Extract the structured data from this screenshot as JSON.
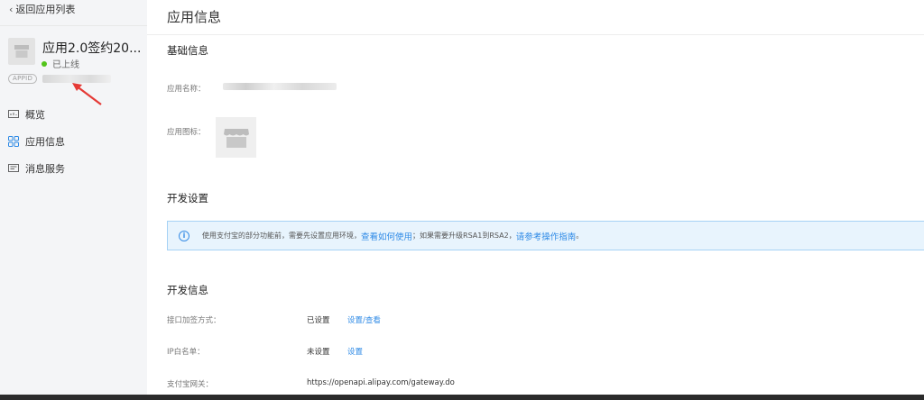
{
  "sidebar": {
    "back_label": "返回应用列表",
    "app": {
      "name": "应用2.0签约20...",
      "status": "已上线",
      "appid_badge": "APPID"
    },
    "nav": [
      {
        "label": "概览",
        "icon": "overview-icon"
      },
      {
        "label": "应用信息",
        "icon": "grid-icon"
      },
      {
        "label": "消息服务",
        "icon": "message-icon"
      }
    ]
  },
  "main": {
    "title": "应用信息",
    "basic": {
      "title": "基础信息",
      "name_label": "应用名称：",
      "icon_label": "应用图标："
    },
    "dev_settings": {
      "title": "开发设置",
      "banner_text_1": "使用支付宝的部分功能前，需要先设置应用环境，",
      "banner_link_1": "查看如何使用",
      "banner_text_2": "；如果需要升级RSA1到RSA2，",
      "banner_link_2": "请参考操作指南",
      "banner_end": "。"
    },
    "dev_info": {
      "title": "开发信息",
      "rows": [
        {
          "label": "接口加签方式：",
          "value": "已设置",
          "link": "设置/查看"
        },
        {
          "label": "IP白名单：",
          "value": "未设置",
          "link": "设置"
        },
        {
          "label": "支付宝网关：",
          "value": "https://openapi.alipay.com/gateway.do",
          "link": ""
        }
      ]
    }
  },
  "colors": {
    "accent": "#2e8ae6",
    "status_online": "#52c41a",
    "banner_bg": "#e8f4fd",
    "annotation": "#e53935"
  }
}
